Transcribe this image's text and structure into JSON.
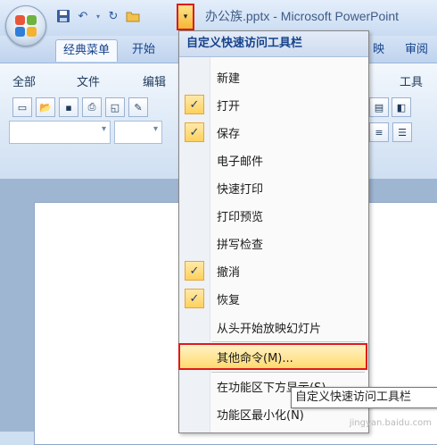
{
  "window": {
    "title": "办公族.pptx - Microsoft PowerPoint"
  },
  "tabs": [
    "经典菜单",
    "开始",
    "映",
    "审阅"
  ],
  "classic_menu": [
    "全部",
    "文件",
    "编辑",
    "工具"
  ],
  "qat_dropdown": {
    "title": "自定义快速访问工具栏",
    "items": [
      {
        "label": "新建",
        "checked": false
      },
      {
        "label": "打开",
        "checked": true
      },
      {
        "label": "保存",
        "checked": true
      },
      {
        "label": "电子邮件",
        "checked": false
      },
      {
        "label": "快速打印",
        "checked": false
      },
      {
        "label": "打印预览",
        "checked": false
      },
      {
        "label": "拼写检查",
        "checked": false
      },
      {
        "label": "撤消",
        "checked": true
      },
      {
        "label": "恢复",
        "checked": true
      },
      {
        "label": "从头开始放映幻灯片",
        "checked": false
      },
      {
        "label": "其他命令(M)...",
        "checked": false,
        "highlighted": true
      },
      {
        "label": "在功能区下方显示(S)",
        "checked": false
      },
      {
        "label": "功能区最小化(N)",
        "checked": false
      }
    ]
  },
  "tooltip": "自定义快速访问工具栏",
  "watermark": "jingyan.baidu.com",
  "colors": {
    "highlight_border": "#e01a1a",
    "check_bg": "#ffd15c",
    "ribbon_text": "#15428b"
  },
  "icons": [
    "office-button",
    "save-icon",
    "undo-icon",
    "redo-icon",
    "open-icon",
    "qat-dropdown-arrow"
  ]
}
